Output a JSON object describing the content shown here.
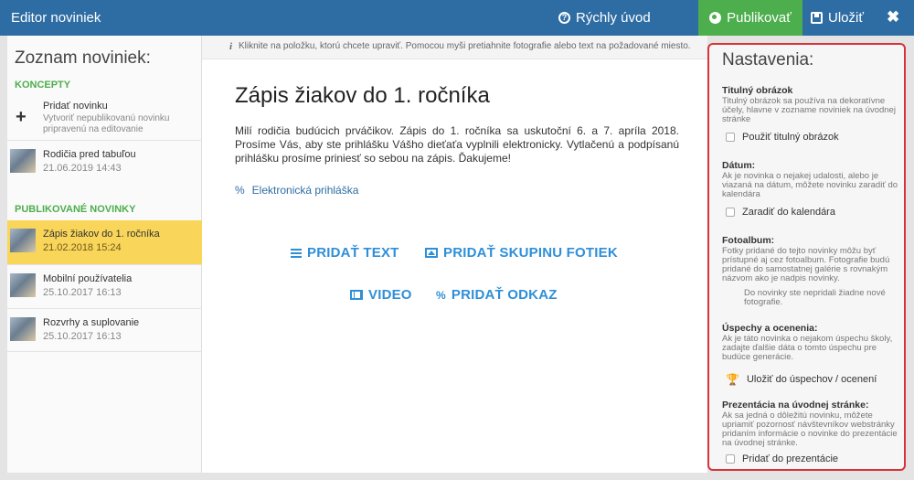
{
  "topbar": {
    "title": "Editor noviniek",
    "help_label": "Rýchly úvod",
    "publish_label": "Publikovať",
    "save_label": "Uložiť",
    "close_glyph": "✖",
    "colors": {
      "bar": "#2e6da4",
      "publish": "#4cae4c"
    }
  },
  "sidebar": {
    "heading": "Zoznam noviniek:",
    "drafts_label": "KONCEPTY",
    "add": {
      "label": "Pridať novinku",
      "description": "Vytvoriť nepublikovanú novinku pripravenú na editovanie"
    },
    "drafts": [
      {
        "label": "Rodičia pred tabuľou",
        "date": "21.06.2019 14:43"
      }
    ],
    "published_label": "PUBLIKOVANÉ NOVINKY",
    "published": [
      {
        "label": "Zápis žiakov do 1. ročníka",
        "date": "21.02.2018 15:24",
        "active": true
      },
      {
        "label": "Mobilní používatelia",
        "date": "25.10.2017 16:13",
        "active": false
      },
      {
        "label": "Rozvrhy a suplovanie",
        "date": "25.10.2017 16:13",
        "active": false
      }
    ]
  },
  "main": {
    "hint": "Kliknite na položku, ktorú chcete upraviť. Pomocou myši pretiahnite fotografie alebo text na požadované miesto.",
    "title": "Zápis žiakov do 1. ročníka",
    "body": "Milí rodičia budúcich prváčikov. Zápis do 1. ročníka sa uskutoční 6. a 7. apríla 2018. Prosíme Vás, aby ste prihlášku Vášho dieťaťa vyplnili elektronicky. Vytlačenú a podpísanú prihlášku prosíme priniesť so sebou na zápis. Ďakujeme!",
    "link_label": "Elektronická prihláška",
    "actions": {
      "add_text": "PRIDAŤ TEXT",
      "add_gallery": "PRIDAŤ SKUPINU FOTIEK",
      "video": "VIDEO",
      "add_link": "PRIDAŤ ODKAZ"
    }
  },
  "settings": {
    "heading": "Nastavenia:",
    "cover": {
      "title": "Titulný obrázok",
      "desc": "Titulný obrázok sa používa na dekoratívne účely, hlavne v zozname noviniek na úvodnej stránke",
      "check": "Použiť titulný obrázok"
    },
    "date": {
      "title": "Dátum:",
      "desc": "Ak je novinka o nejakej udalosti, alebo je viazaná na dátum, môžete novinku zaradiť do kalendára",
      "check": "Zaradiť do kalendára"
    },
    "album": {
      "title": "Fotoalbum:",
      "desc": "Fotky pridané do tejto novinky môžu byť prístupné aj cez fotoalbum. Fotografie budú pridané do samostatnej galérie s rovnakým názvom ako je nadpis novinky.",
      "note": "Do novinky ste nepridali žiadne nové fotografie."
    },
    "achievements": {
      "title": "Úspechy a ocenenia:",
      "desc": "Ak je táto novinka o nejakom úspechu školy, zadajte ďalšie dáta o tomto úspechu pre budúce generácie.",
      "action": "Uložiť do úspechov / ocenení"
    },
    "presentation": {
      "title": "Prezentácia na úvodnej stránke:",
      "desc": "Ak sa jedná o dôležitú novinku, môžete upriamiť pozornosť návštevníkov webstránky pridaním informácie o novinke do prezentácie na úvodnej stránke.",
      "check": "Pridať do prezentácie"
    },
    "border_color": "#d9323a"
  }
}
